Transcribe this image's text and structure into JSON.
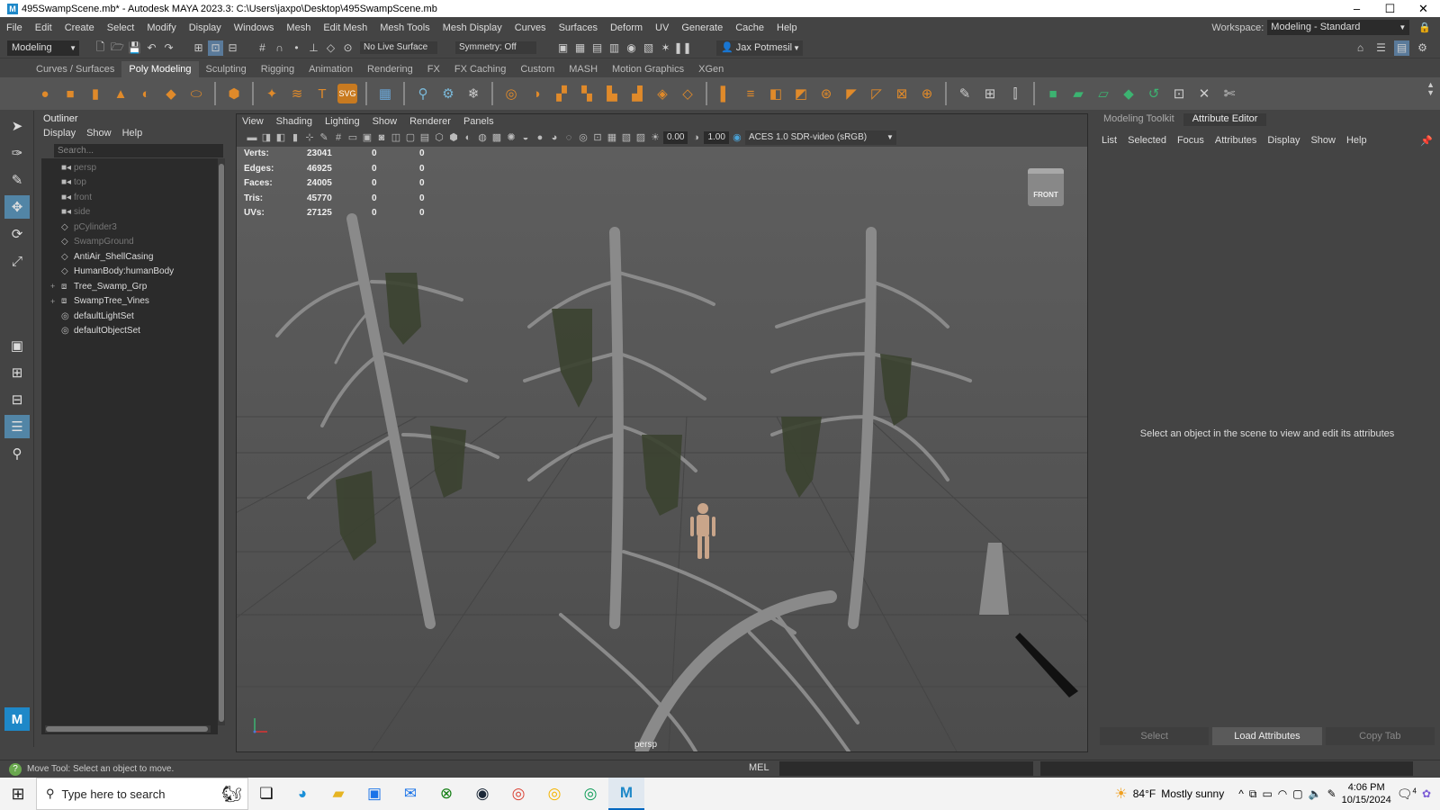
{
  "window": {
    "title": "495SwampScene.mb* - Autodesk MAYA 2023.3: C:\\Users\\jaxpo\\Desktop\\495SwampScene.mb",
    "app_icon": "M"
  },
  "menubar": {
    "items": [
      "File",
      "Edit",
      "Create",
      "Select",
      "Modify",
      "Display",
      "Windows",
      "Mesh",
      "Edit Mesh",
      "Mesh Tools",
      "Mesh Display",
      "Curves",
      "Surfaces",
      "Deform",
      "UV",
      "Generate",
      "Cache",
      "Help"
    ],
    "workspace_label": "Workspace:",
    "workspace_value": "Modeling - Standard"
  },
  "statusline": {
    "mode": "Modeling",
    "live_surface": "No Live Surface",
    "symmetry": "Symmetry: Off",
    "user": "Jax Potmesil"
  },
  "shelf": {
    "tabs": [
      "Curves / Surfaces",
      "Poly Modeling",
      "Sculpting",
      "Rigging",
      "Animation",
      "Rendering",
      "FX",
      "FX Caching",
      "Custom",
      "MASH",
      "Motion Graphics",
      "XGen"
    ],
    "active_tab": "Poly Modeling"
  },
  "outliner": {
    "title": "Outliner",
    "menu": [
      "Display",
      "Show",
      "Help"
    ],
    "search_placeholder": "Search...",
    "items": [
      {
        "label": "persp",
        "icon": "camera-icon",
        "dim": true,
        "expand": ""
      },
      {
        "label": "top",
        "icon": "camera-icon",
        "dim": true,
        "expand": ""
      },
      {
        "label": "front",
        "icon": "camera-icon",
        "dim": true,
        "expand": ""
      },
      {
        "label": "side",
        "icon": "camera-icon",
        "dim": true,
        "expand": ""
      },
      {
        "label": "pCylinder3",
        "icon": "mesh-icon",
        "dim": true,
        "expand": ""
      },
      {
        "label": "SwampGround",
        "icon": "mesh-icon",
        "dim": true,
        "expand": ""
      },
      {
        "label": "AntiAir_ShellCasing",
        "icon": "mesh-icon",
        "dim": false,
        "expand": ""
      },
      {
        "label": "HumanBody:humanBody",
        "icon": "mesh-icon",
        "dim": false,
        "expand": ""
      },
      {
        "label": "Tree_Swamp_Grp",
        "icon": "group-icon",
        "dim": false,
        "expand": "+"
      },
      {
        "label": "SwampTree_Vines",
        "icon": "group-icon",
        "dim": false,
        "expand": "+"
      },
      {
        "label": "defaultLightSet",
        "icon": "set-icon",
        "dim": false,
        "expand": ""
      },
      {
        "label": "defaultObjectSet",
        "icon": "set-icon",
        "dim": false,
        "expand": ""
      }
    ]
  },
  "viewport": {
    "menu": [
      "View",
      "Shading",
      "Lighting",
      "Show",
      "Renderer",
      "Panels"
    ],
    "exposure": "0.00",
    "gamma": "1.00",
    "color_space": "ACES 1.0 SDR-video (sRGB)",
    "hud": [
      {
        "label": "Verts:",
        "v1": "23041",
        "v2": "0",
        "v3": "0"
      },
      {
        "label": "Edges:",
        "v1": "46925",
        "v2": "0",
        "v3": "0"
      },
      {
        "label": "Faces:",
        "v1": "24005",
        "v2": "0",
        "v3": "0"
      },
      {
        "label": "Tris:",
        "v1": "45770",
        "v2": "0",
        "v3": "0"
      },
      {
        "label": "UVs:",
        "v1": "27125",
        "v2": "0",
        "v3": "0"
      }
    ],
    "viewcube_label": "FRONT",
    "camera_label": "persp"
  },
  "attribute_editor": {
    "tabs": [
      "Modeling Toolkit",
      "Attribute Editor"
    ],
    "active_tab": "Attribute Editor",
    "menu": [
      "List",
      "Selected",
      "Focus",
      "Attributes",
      "Display",
      "Show",
      "Help"
    ],
    "message": "Select an object in the scene to view and edit its attributes",
    "buttons": [
      "Select",
      "Load Attributes",
      "Copy Tab"
    ]
  },
  "helpline": {
    "text": "Move Tool: Select an object to move.",
    "mel_label": "MEL"
  },
  "taskbar": {
    "search_placeholder": "Type here to search",
    "weather_temp": "84°F",
    "weather_desc": "Mostly sunny",
    "time": "4:06 PM",
    "date": "10/15/2024",
    "notif_count": "4"
  },
  "colors": {
    "accent": "#5285a6",
    "shelf_icon": "#e08a2a",
    "viewport_bg": "#5a5a5a"
  }
}
